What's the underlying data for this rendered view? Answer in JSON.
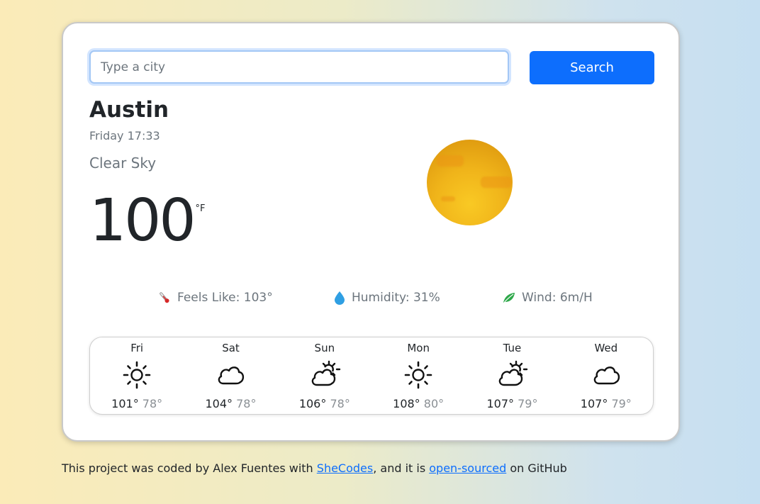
{
  "search": {
    "placeholder": "Type a city",
    "button_label": "Search"
  },
  "current": {
    "city": "Austin",
    "datetime": "Friday 17:33",
    "description": "Clear Sky",
    "temperature": "100",
    "unit": "°F",
    "icon": "clear-sky-sun-icon"
  },
  "details": {
    "feels_like": "Feels Like: 103°",
    "humidity": "Humidity: 31%",
    "wind": "Wind: 6m/H",
    "feels_like_icon": "thermometer-icon",
    "humidity_icon": "water-drop-icon",
    "wind_icon": "leaf-wind-icon"
  },
  "forecast": [
    {
      "day": "Fri",
      "icon": "sun-icon",
      "high": "101°",
      "low": "78°"
    },
    {
      "day": "Sat",
      "icon": "cloud-icon",
      "high": "104°",
      "low": "78°"
    },
    {
      "day": "Sun",
      "icon": "partly-cloudy-icon",
      "high": "106°",
      "low": "78°"
    },
    {
      "day": "Mon",
      "icon": "sun-icon",
      "high": "108°",
      "low": "80°"
    },
    {
      "day": "Tue",
      "icon": "partly-cloudy-icon",
      "high": "107°",
      "low": "79°"
    },
    {
      "day": "Wed",
      "icon": "cloud-icon",
      "high": "107°",
      "low": "79°"
    }
  ],
  "footer": {
    "prefix": "This project was coded by Alex Fuentes with ",
    "link1": "SheCodes",
    "middle": ", and it is ",
    "link2": "open-sourced",
    "suffix": " on GitHub"
  },
  "colors": {
    "accent": "#0d6efd",
    "sun": "#f0b41a"
  }
}
